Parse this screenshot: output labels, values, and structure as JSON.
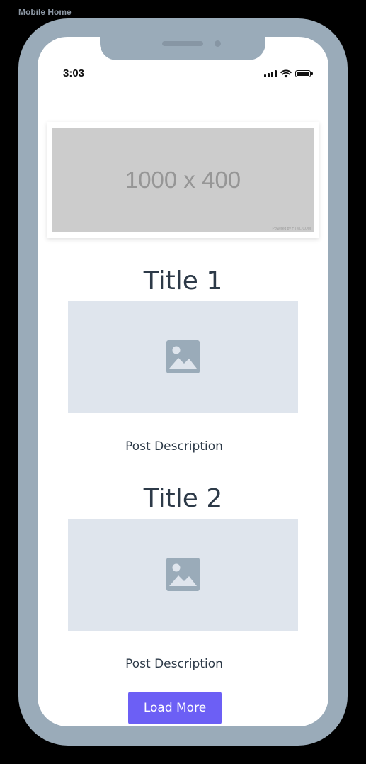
{
  "frame_label": "Mobile Home",
  "status_bar": {
    "time": "3:03",
    "icons": [
      "signal-icon",
      "wifi-icon",
      "battery-icon"
    ]
  },
  "banner": {
    "placeholder_text": "1000 x 400",
    "credit_text": "Powered by HTML.COM"
  },
  "posts": [
    {
      "title": "Title 1",
      "image_icon": "image-icon",
      "description": "Post Description"
    },
    {
      "title": "Title 2",
      "image_icon": "image-icon",
      "description": "Post Description"
    }
  ],
  "load_more_label": "Load More",
  "colors": {
    "background": "#000000",
    "device_frame": "#9aabb9",
    "screen": "#ffffff",
    "text": "#2d3a48",
    "image_placeholder": "#dfe5ed",
    "image_icon": "#9aabb9",
    "button": "#6c5ff5",
    "button_text": "#ffffff"
  }
}
